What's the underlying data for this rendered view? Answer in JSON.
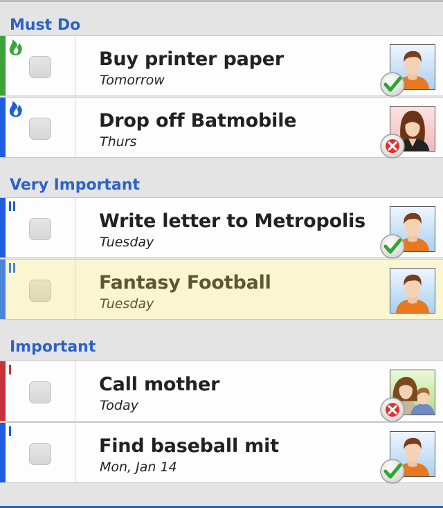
{
  "colors": {
    "section_header": "#2a62cc",
    "stripe_green": "#3aa33a",
    "stripe_blue": "#1f5de0",
    "stripe_lightblue": "#4a86d8",
    "stripe_red": "#c8323c",
    "highlight_row": "#fbf6d2"
  },
  "sections": [
    {
      "header": "Must Do",
      "tasks": [
        {
          "title": "Buy printer paper",
          "due": "Tomorrow",
          "priority_icon": "flame-icon",
          "stripe": "green",
          "avatar": "man-avatar",
          "status": "checkmark-icon"
        },
        {
          "title": "Drop off Batmobile",
          "due": "Thurs",
          "priority_icon": "flame-icon",
          "stripe": "blue",
          "avatar": "woman-avatar",
          "status": "x-icon"
        }
      ]
    },
    {
      "header": "Very Important",
      "tasks": [
        {
          "title": "Write letter to Metropolis",
          "due": "Tuesday",
          "priority_icon": "double-bar-icon",
          "stripe": "blue",
          "avatar": "man-avatar",
          "status": "checkmark-icon"
        },
        {
          "title": "Fantasy Football",
          "due": "Tuesday",
          "priority_icon": "double-bar-icon",
          "stripe": "lightblue",
          "avatar": "man-avatar",
          "status": "none",
          "highlighted": true
        }
      ]
    },
    {
      "header": "Important",
      "tasks": [
        {
          "title": "Call mother",
          "due": "Today",
          "priority_icon": "single-bar-icon",
          "stripe": "red",
          "avatar": "couple-avatar",
          "status": "x-icon"
        },
        {
          "title": "Find baseball mit",
          "due": "Mon, Jan 14",
          "priority_icon": "single-bar-icon",
          "stripe": "blue",
          "avatar": "man-avatar",
          "status": "checkmark-icon"
        }
      ]
    }
  ]
}
